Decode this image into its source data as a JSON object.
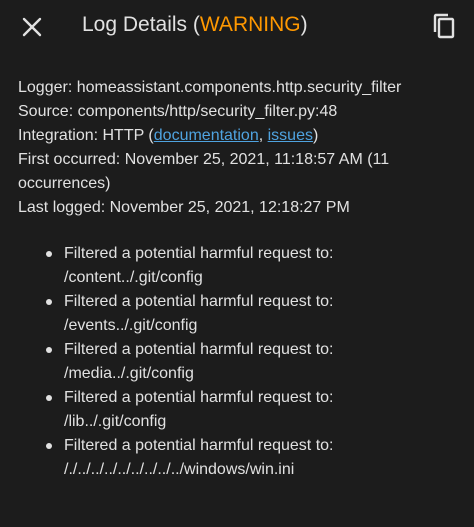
{
  "header": {
    "title_prefix": "Log Details (",
    "level": "WARNING",
    "title_suffix": ")",
    "close_icon": "close-icon",
    "copy_icon": "copy-icon",
    "level_color": "#ff9800"
  },
  "details": {
    "logger_label": "Logger: ",
    "logger_value": "homeassistant.components.http.security_filter",
    "source_label": "Source: ",
    "source_value": "components/http/security_filter.py:48",
    "integration_label": "Integration: ",
    "integration_value": "HTTP",
    "integration_open": " (",
    "documentation_link": "documentation",
    "link_separator": ", ",
    "issues_link": "issues",
    "integration_close": ")",
    "first_occurred_label": "First occurred: ",
    "first_occurred_value": "November 25, 2021, 11:18:57 AM (11 occurrences)",
    "last_logged_label": "Last logged: ",
    "last_logged_value": "November 25, 2021, 12:18:27 PM",
    "link_color": "#4fa3e0"
  },
  "messages": [
    {
      "line1": "Filtered a potential harmful request to:",
      "line2": "/content../.git/config"
    },
    {
      "line1": "Filtered a potential harmful request to:",
      "line2": "/events../.git/config"
    },
    {
      "line1": "Filtered a potential harmful request to:",
      "line2": "/media../.git/config"
    },
    {
      "line1": "Filtered a potential harmful request to:",
      "line2": "/lib../.git/config"
    },
    {
      "line1": "Filtered a potential harmful request to:",
      "line2": "/./../../../../../../../../windows/win.ini"
    }
  ]
}
